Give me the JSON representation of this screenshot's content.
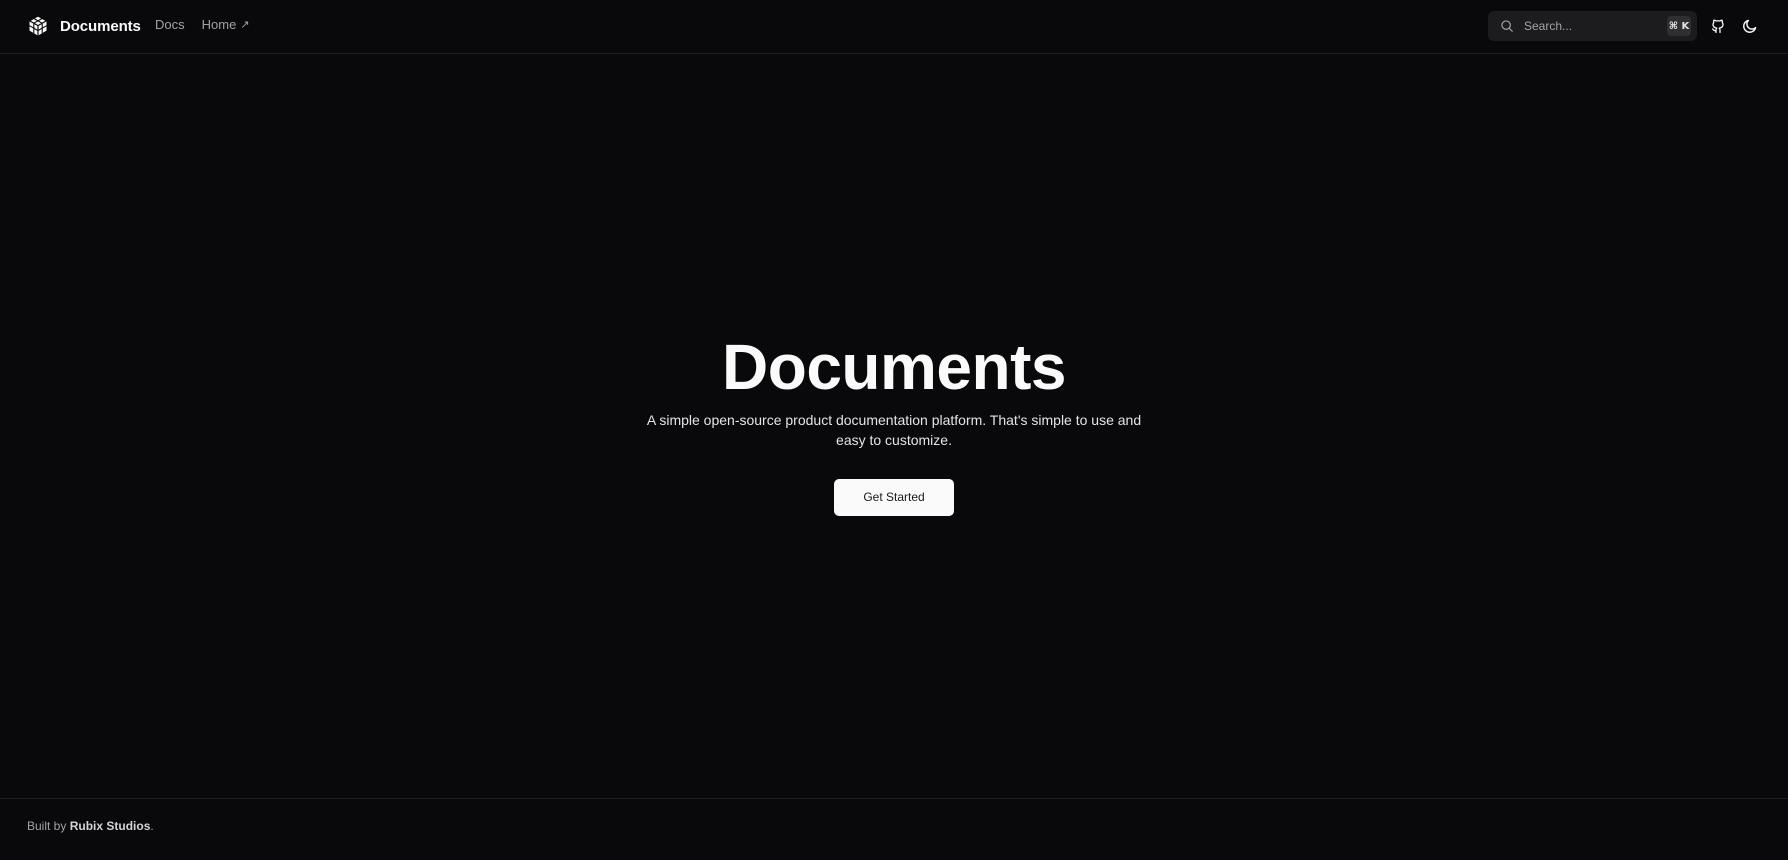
{
  "header": {
    "brand_name": "Documents",
    "nav": [
      {
        "label": "Docs"
      },
      {
        "label": "Home",
        "external_icon": "arrow-up-right-icon"
      }
    ],
    "search": {
      "placeholder": "Search...",
      "shortcut": "⌘ K"
    },
    "icons": [
      "github-icon",
      "theme-toggle-moon-icon"
    ]
  },
  "hero": {
    "title": "Documents",
    "subtitle": "A simple open-source product documentation platform. That's simple to use and easy to customize.",
    "cta_label": "Get Started"
  },
  "footer": {
    "prefix": "Built by",
    "credit": "Rubix Studios",
    "suffix": "."
  },
  "colors": {
    "background": "#09090b",
    "text": "#fafafa",
    "muted": "#a1a1aa",
    "border": "#1f1f23",
    "search_bg": "#1c1c1f",
    "button_bg": "#fafafa",
    "button_text": "#18181b"
  }
}
